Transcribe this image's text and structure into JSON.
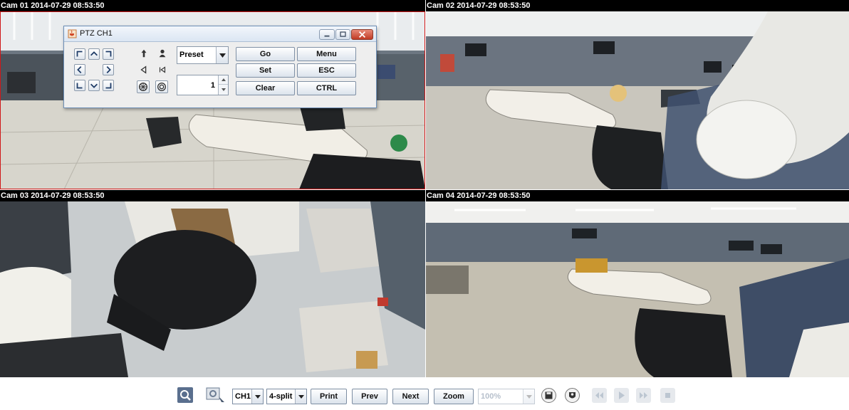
{
  "cameras": [
    {
      "label": "Cam 01 2014-07-29 08:53:50"
    },
    {
      "label": "Cam 02 2014-07-29 08:53:50"
    },
    {
      "label": "Cam 03 2014-07-29 08:53:50"
    },
    {
      "label": "Cam 04 2014-07-29 08:53:50"
    }
  ],
  "ptz_dialog": {
    "title": "PTZ CH1",
    "preset_select": "Preset",
    "preset_number": "1",
    "buttons": {
      "go": "Go",
      "menu": "Menu",
      "set": "Set",
      "esc": "ESC",
      "clear": "Clear",
      "ctrl": "CTRL"
    },
    "icons": {
      "app": "java-cup-icon",
      "minimize": "minimize-icon",
      "maximize": "maximize-icon",
      "close": "close-icon"
    }
  },
  "toolbar": {
    "channel_select": "CH1",
    "split_select": "4-split",
    "print_label": "Print",
    "prev_label": "Prev",
    "next_label": "Next",
    "zoom_label": "Zoom",
    "zoom_level": "100%",
    "icons": [
      "search-icon",
      "ptz-settings-icon",
      "save-icon",
      "record-icon",
      "rewind-icon",
      "play-icon",
      "fast-forward-icon",
      "stop-icon"
    ]
  },
  "colors": {
    "selected_border": "#d01818",
    "dialog_border": "#6d8fb7",
    "close_button": "#c84a34"
  }
}
